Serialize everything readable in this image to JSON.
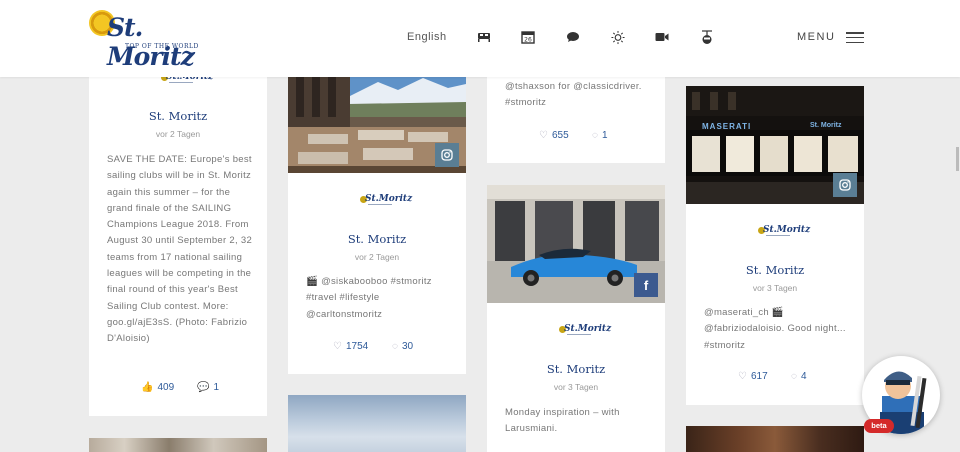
{
  "header": {
    "logo_text": "St. Moritz",
    "logo_tagline": "TOP OF THE WORLD",
    "language": "English",
    "menu_label": "MENU",
    "icons": [
      "bed-icon",
      "calendar-icon",
      "chat-icon",
      "sun-icon",
      "video-icon",
      "lift-icon"
    ]
  },
  "cards": {
    "c1": {
      "title": "St. Moritz",
      "time": "vor 2 Tagen",
      "text": "SAVE THE DATE: Europe's best sailing clubs will be in St. Moritz again this summer – for the grand finale of the SAILING Champions League 2018. From August 30 until September 2, 32 teams from 17 national sailing leagues will be competing in the final round of this year's Best Sailing Club contest. More: goo.gl/ajE3sS. (Photo: Fabrizio D'Aloisio)",
      "likes": "409",
      "comments": "1"
    },
    "c2": {
      "title": "St. Moritz",
      "time": "vor 2 Tagen",
      "text": "🎬 @siskabooboo #stmoritz #travel #lifestyle @carltonstmoritz",
      "likes": "1754",
      "comments": "30"
    },
    "c3": {
      "text": "@tshaxson for @classicdriver. #stmoritz",
      "likes": "655",
      "comments": "1"
    },
    "c4": {
      "title": "St. Moritz",
      "time": "vor 3 Tagen",
      "text": "Monday inspiration – with Larusmiani."
    },
    "c5": {
      "title": "St. Moritz",
      "time": "vor 3 Tagen",
      "text": "@maserati_ch 🎬 @fabriziodaloisio. Good night... #stmoritz",
      "likes": "617",
      "comments": "4",
      "shop_sign_left": "MASERATI",
      "shop_sign_right": "St. Moritz"
    }
  },
  "helper": {
    "badge": "beta"
  },
  "colors": {
    "brand_blue": "#1e3d7a",
    "link_blue": "#2e5a99",
    "instagram_badge": "#5a7e94",
    "facebook_badge": "#3c5a8f",
    "beta_red": "#d42a2a"
  }
}
